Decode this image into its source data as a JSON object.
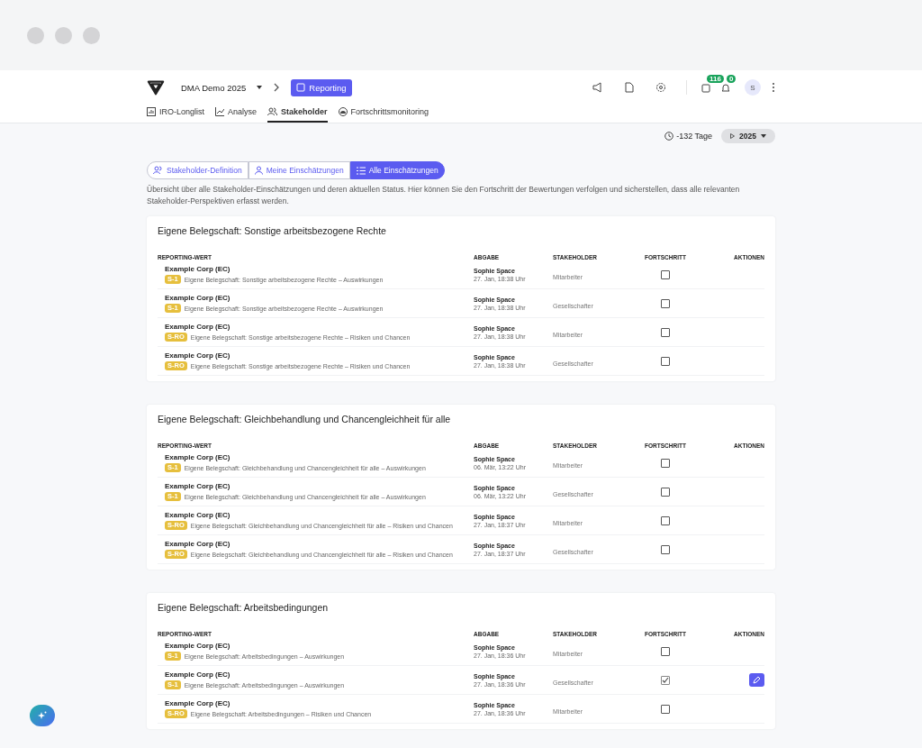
{
  "header": {
    "project": "DMA Demo 2025",
    "module": "Reporting",
    "tasks_badge": "116",
    "notifications_badge": "0",
    "avatar": "S"
  },
  "nav": [
    {
      "label": "IRO-Longlist",
      "selected": false
    },
    {
      "label": "Analyse",
      "selected": false
    },
    {
      "label": "Stakeholder",
      "selected": true
    },
    {
      "label": "Fortschrittsmonitoring",
      "selected": false
    }
  ],
  "deadline": "-132 Tage",
  "year": "2025",
  "segments": [
    {
      "label": "Stakeholder-Definition",
      "selected": false
    },
    {
      "label": "Meine Einschätzungen",
      "selected": false
    },
    {
      "label": "Alle Einschätzungen",
      "selected": true
    }
  ],
  "intro": "Übersicht über alle Stakeholder-Einschätzungen und deren aktuellen Status. Hier können Sie den Fortschritt der Bewertungen verfolgen und sicherstellen, dass alle relevanten Stakeholder-Perspektiven erfasst werden.",
  "sections": [
    {
      "title": "Eigene Belegschaft: Sonstige arbeitsbezogene Rechte",
      "columns": [
        "REPORTING-WERT",
        "ABGABE",
        "STAKEHOLDER",
        "FORTSCHRITT",
        "AKTIONEN"
      ],
      "rows": [
        {
          "company": "Example Corp (EC)",
          "tag": "S-1",
          "topic": "Eigene Belegschaft: Sonstige arbeitsbezogene Rechte – Auswirkungen",
          "person": "Sophie Space",
          "date": "27. Jan, 18:38 Uhr",
          "stakeholder": "Mitarbeiter",
          "checked": false,
          "editable": false
        },
        {
          "company": "Example Corp (EC)",
          "tag": "S-1",
          "topic": "Eigene Belegschaft: Sonstige arbeitsbezogene Rechte – Auswirkungen",
          "person": "Sophie Space",
          "date": "27. Jan, 18:38 Uhr",
          "stakeholder": "Gesellschafter",
          "checked": false,
          "editable": false
        },
        {
          "company": "Example Corp (EC)",
          "tag": "S-RO",
          "topic": "Eigene Belegschaft: Sonstige arbeitsbezogene Rechte – Risiken und Chancen",
          "person": "Sophie Space",
          "date": "27. Jan, 18:38 Uhr",
          "stakeholder": "Mitarbeiter",
          "checked": false,
          "editable": false
        },
        {
          "company": "Example Corp (EC)",
          "tag": "S-RO",
          "topic": "Eigene Belegschaft: Sonstige arbeitsbezogene Rechte – Risiken und Chancen",
          "person": "Sophie Space",
          "date": "27. Jan, 18:38 Uhr",
          "stakeholder": "Gesellschafter",
          "checked": false,
          "editable": false
        }
      ]
    },
    {
      "title": "Eigene Belegschaft: Gleichbehandlung und Chancengleichheit für alle",
      "columns": [
        "REPORTING-WERT",
        "ABGABE",
        "STAKEHOLDER",
        "FORTSCHRITT",
        "AKTIONEN"
      ],
      "rows": [
        {
          "company": "Example Corp (EC)",
          "tag": "S-1",
          "topic": "Eigene Belegschaft: Gleichbehandlung und Chancengleichheit für alle – Auswirkungen",
          "person": "Sophie Space",
          "date": "06. Mär, 13:22 Uhr",
          "stakeholder": "Mitarbeiter",
          "checked": false,
          "editable": false
        },
        {
          "company": "Example Corp (EC)",
          "tag": "S-1",
          "topic": "Eigene Belegschaft: Gleichbehandlung und Chancengleichheit für alle – Auswirkungen",
          "person": "Sophie Space",
          "date": "06. Mär, 13:22 Uhr",
          "stakeholder": "Gesellschafter",
          "checked": false,
          "editable": false
        },
        {
          "company": "Example Corp (EC)",
          "tag": "S-RO",
          "topic": "Eigene Belegschaft: Gleichbehandlung und Chancengleichheit für alle – Risiken und Chancen",
          "person": "Sophie Space",
          "date": "27. Jan, 18:37 Uhr",
          "stakeholder": "Mitarbeiter",
          "checked": false,
          "editable": false
        },
        {
          "company": "Example Corp (EC)",
          "tag": "S-RO",
          "topic": "Eigene Belegschaft: Gleichbehandlung und Chancengleichheit für alle – Risiken und Chancen",
          "person": "Sophie Space",
          "date": "27. Jan, 18:37 Uhr",
          "stakeholder": "Gesellschafter",
          "checked": false,
          "editable": false
        }
      ]
    },
    {
      "title": "Eigene Belegschaft: Arbeitsbedingungen",
      "columns": [
        "REPORTING-WERT",
        "ABGABE",
        "STAKEHOLDER",
        "FORTSCHRITT",
        "AKTIONEN"
      ],
      "rows": [
        {
          "company": "Example Corp (EC)",
          "tag": "S-1",
          "topic": "Eigene Belegschaft: Arbeitsbedingungen – Auswirkungen",
          "person": "Sophie Space",
          "date": "27. Jan, 18:36 Uhr",
          "stakeholder": "Mitarbeiter",
          "checked": false,
          "editable": false
        },
        {
          "company": "Example Corp (EC)",
          "tag": "S-1",
          "topic": "Eigene Belegschaft: Arbeitsbedingungen – Auswirkungen",
          "person": "Sophie Space",
          "date": "27. Jan, 18:36 Uhr",
          "stakeholder": "Gesellschafter",
          "checked": true,
          "editable": true
        },
        {
          "company": "Example Corp (EC)",
          "tag": "S-RO",
          "topic": "Eigene Belegschaft: Arbeitsbedingungen – Risiken und Chancen",
          "person": "Sophie Space",
          "date": "27. Jan, 18:36 Uhr",
          "stakeholder": "Mitarbeiter",
          "checked": false,
          "editable": false
        }
      ]
    }
  ]
}
